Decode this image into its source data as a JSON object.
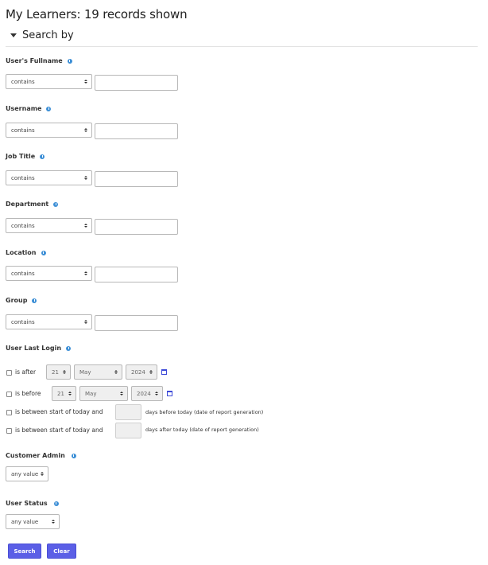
{
  "header": {
    "title": "My Learners: 19 records shown",
    "search_by": "Search by"
  },
  "fields": [
    {
      "label": "User's Fullname",
      "operator": "contains",
      "value": ""
    },
    {
      "label": "Username",
      "operator": "contains",
      "value": ""
    },
    {
      "label": "Job Title",
      "operator": "contains",
      "value": ""
    },
    {
      "label": "Department",
      "operator": "contains",
      "value": ""
    },
    {
      "label": "Location",
      "operator": "contains",
      "value": ""
    },
    {
      "label": "Group",
      "operator": "contains",
      "value": ""
    }
  ],
  "last_login": {
    "label": "User Last Login",
    "is_after": {
      "label": "is after",
      "day": "21",
      "month": "May",
      "year": "2024"
    },
    "is_before": {
      "label": "is before",
      "day": "21",
      "month": "May",
      "year": "2024"
    },
    "between_before": {
      "label": "is between start of today and",
      "suffix": "days before today (date of report generation)"
    },
    "between_after": {
      "label": "is between start of today and",
      "suffix": "days after today (date of report generation)"
    }
  },
  "customer_admin": {
    "label": "Customer Admin",
    "value": "any value"
  },
  "user_status": {
    "label": "User Status",
    "value": "any value"
  },
  "buttons": {
    "search": "Search",
    "clear": "Clear"
  },
  "colors": {
    "accent": "#5b5fe6",
    "info": "#3d8fd6"
  }
}
